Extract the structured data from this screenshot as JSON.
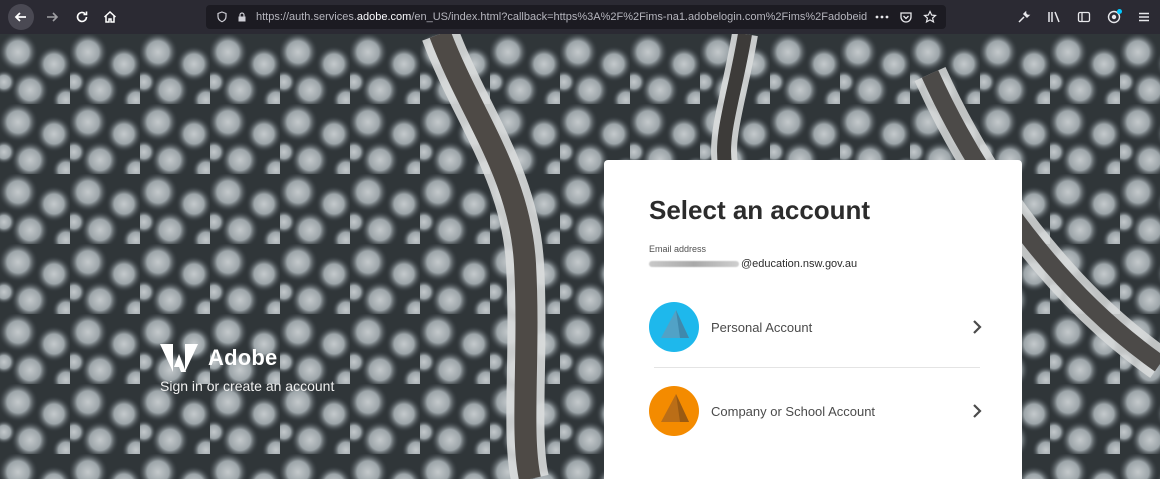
{
  "browser": {
    "url_prefix": "https://auth.services.",
    "url_domain": "adobe.com",
    "url_rest": "/en_US/index.html?callback=https%3A%2F%2Fims-na1.adobelogin.com%2Fims%2Fadobeid",
    "icons": {
      "back": "arrow-left-icon",
      "forward": "arrow-right-icon",
      "reload": "reload-icon",
      "home": "home-icon",
      "shield": "shield-icon",
      "lock": "lock-icon",
      "more": "ellipsis-icon",
      "pocket": "pocket-icon",
      "bookmark": "star-icon",
      "tools": "wrench-icon",
      "library": "library-icon",
      "sidebar": "sidebar-icon",
      "account": "extension-icon",
      "menu": "hamburger-icon"
    }
  },
  "brand": {
    "name": "Adobe",
    "tagline": "Sign in or create an account",
    "logo_color": "#ffffff"
  },
  "card": {
    "title": "Select an account",
    "email_label": "Email address",
    "email_suffix": "@education.nsw.gov.au",
    "accounts": [
      {
        "label": "Personal Account",
        "color": "#29b7ea"
      },
      {
        "label": "Company or School Account",
        "color": "#f08c00"
      }
    ]
  }
}
